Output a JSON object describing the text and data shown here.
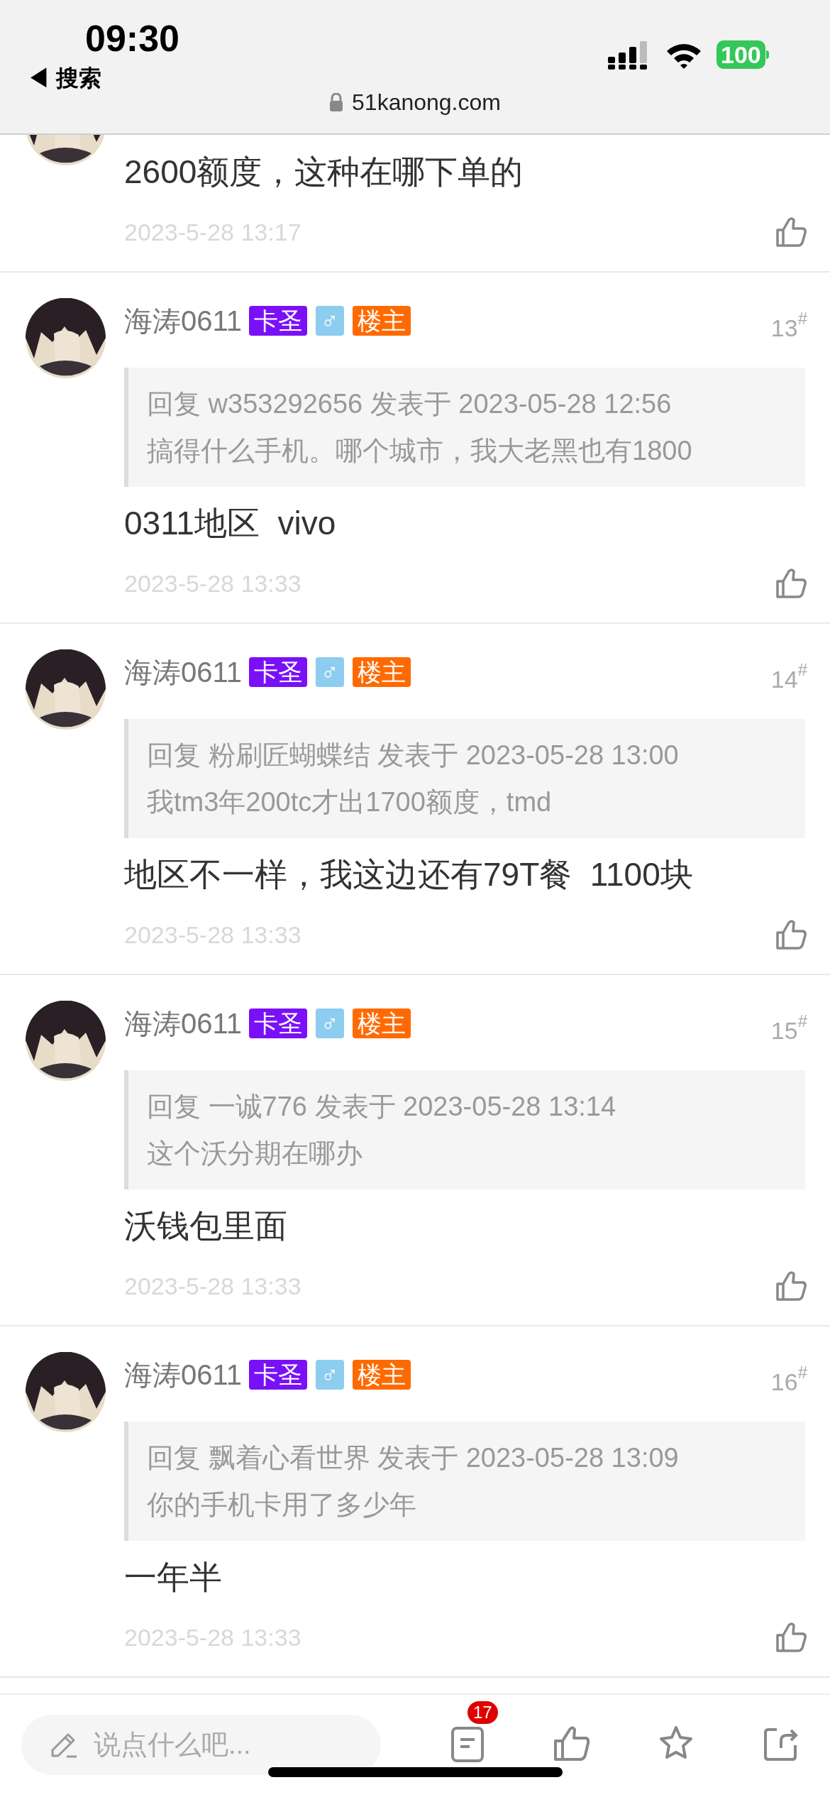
{
  "status_bar": {
    "time": "09:30",
    "back_label": "◀ 搜索",
    "battery": "100"
  },
  "address_bar": {
    "url": "51kanong.com"
  },
  "posts": [
    {
      "kind": "partial",
      "body": "2600额度，这种在哪下单的",
      "date": "2023-5-28 13:17"
    },
    {
      "kind": "reply",
      "user": "海涛0611",
      "badges": [
        {
          "text": "卡圣",
          "color": "#7a10f7"
        },
        {
          "text": "♂",
          "color": "#8ccdf0"
        },
        {
          "text": "楼主",
          "color": "#ff6a00"
        }
      ],
      "floor": "13",
      "floor_mark": "#",
      "quote_header": "回复 w353292656 发表于 2023-05-28 12:56",
      "quote_text": "搞得什么手机。哪个城市，我大老黑也有1800",
      "body": "0311地区  vivo",
      "date": "2023-5-28 13:33"
    },
    {
      "kind": "reply",
      "user": "海涛0611",
      "badges": [
        {
          "text": "卡圣",
          "color": "#7a10f7"
        },
        {
          "text": "♂",
          "color": "#8ccdf0"
        },
        {
          "text": "楼主",
          "color": "#ff6a00"
        }
      ],
      "floor": "14",
      "floor_mark": "#",
      "quote_header": "回复 粉刷匠蝴蝶结 发表于 2023-05-28 13:00",
      "quote_text": "我tm3年200tc才出1700额度，tmd",
      "body": "地区不一样，我这边还有79T餐  1100块",
      "date": "2023-5-28 13:33"
    },
    {
      "kind": "reply",
      "user": "海涛0611",
      "badges": [
        {
          "text": "卡圣",
          "color": "#7a10f7"
        },
        {
          "text": "♂",
          "color": "#8ccdf0"
        },
        {
          "text": "楼主",
          "color": "#ff6a00"
        }
      ],
      "floor": "15",
      "floor_mark": "#",
      "quote_header": "回复 一诚776 发表于 2023-05-28 13:14",
      "quote_text": "这个沃分期在哪办",
      "body": "沃钱包里面",
      "date": "2023-5-28 13:33"
    },
    {
      "kind": "reply",
      "user": "海涛0611",
      "badges": [
        {
          "text": "卡圣",
          "color": "#7a10f7"
        },
        {
          "text": "♂",
          "color": "#8ccdf0"
        },
        {
          "text": "楼主",
          "color": "#ff6a00"
        }
      ],
      "floor": "16",
      "floor_mark": "#",
      "quote_header": "回复 飘着心看世界 发表于 2023-05-28 13:09",
      "quote_text": "你的手机卡用了多少年",
      "body": "一年半",
      "date": "2023-5-28 13:33"
    }
  ],
  "bottom_bar": {
    "comment_placeholder": "说点什么吧...",
    "comment_count": "17"
  }
}
